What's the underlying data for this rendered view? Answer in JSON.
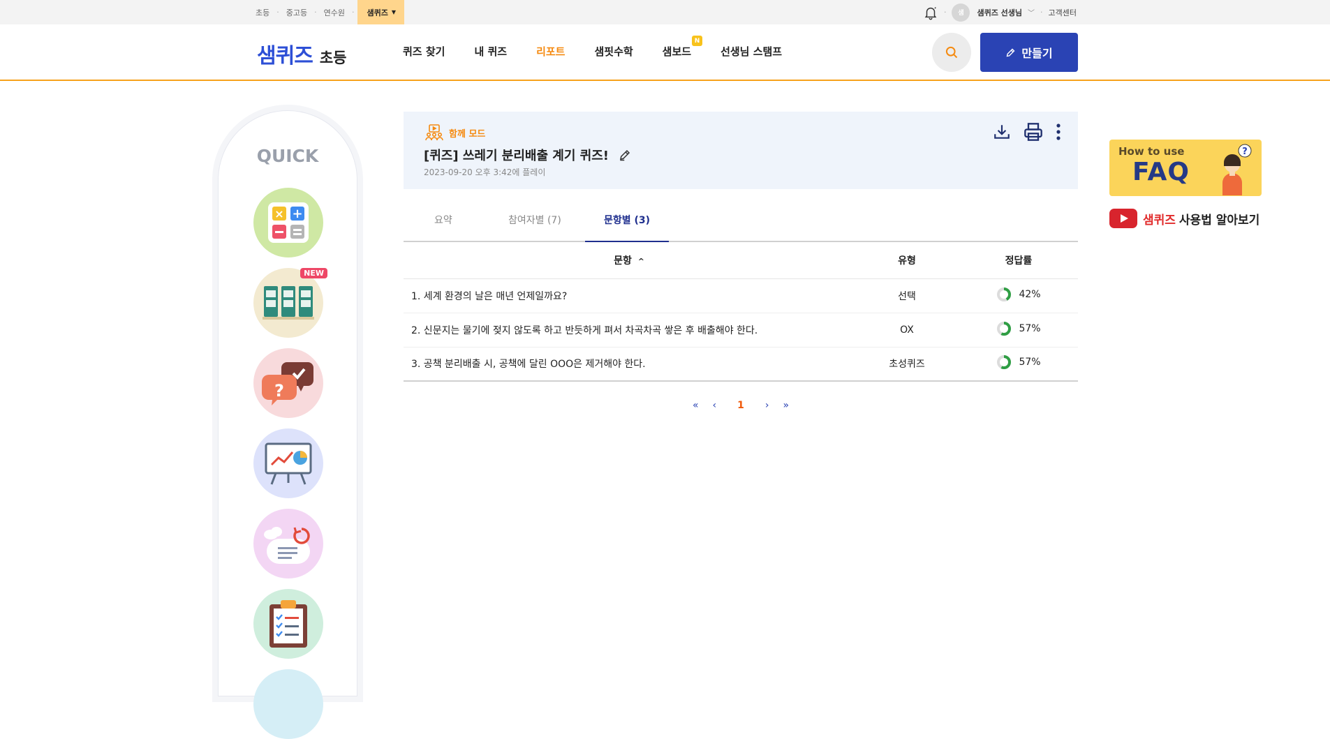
{
  "topbar": {
    "sites": [
      "초등",
      "중고등",
      "연수원"
    ],
    "active_site": "샘퀴즈",
    "user_initial": "샘",
    "user_name": "샘퀴즈 선생님",
    "help": "고객센터"
  },
  "header": {
    "brand": "샘퀴즈",
    "brand_sub": "초등",
    "nav": [
      "퀴즈 찾기",
      "내 퀴즈",
      "리포트",
      "샘핏수학",
      "샘보드",
      "선생님 스탬프"
    ],
    "nav_active_index": 2,
    "new_badge": "N",
    "make_button": "만들기"
  },
  "quick": {
    "title": "QUICK",
    "new_label": "NEW"
  },
  "quiz": {
    "mode": "함께 모드",
    "title": "[퀴즈] 쓰레기 분리배출 계기 퀴즈!",
    "date": "2023-09-20 오후 3:42에 플레이"
  },
  "tabs": [
    "요약",
    "참여자별 (7)",
    "문항별 (3)"
  ],
  "active_tab": 2,
  "table": {
    "headers": [
      "문항",
      "유형",
      "정답률"
    ],
    "sort_indicator": "^",
    "rows": [
      {
        "question": "1. 세계 환경의 날은 매년 언제일까요?",
        "type": "선택",
        "rate": "42%",
        "rate_value": 0.42
      },
      {
        "question": "2. 신문지는 물기에 젖지 않도록 하고 반듯하게 펴서 차곡차곡 쌓은 후 배출해야 한다.",
        "type": "OX",
        "rate": "57%",
        "rate_value": 0.57
      },
      {
        "question": "3. 공책 분리배출 시, 공책에 달린 OOO은 제거해야 한다.",
        "type": "초성퀴즈",
        "rate": "57%",
        "rate_value": 0.57
      }
    ]
  },
  "pager": {
    "first": "«",
    "prev": "‹",
    "current": "1",
    "next": "›",
    "last": "»"
  },
  "banners": {
    "faq_how": "How to use",
    "faq_big": "FAQ",
    "yt_brand": "샘퀴즈",
    "yt_text": "사용법 알아보기"
  },
  "colors": {
    "accent": "#f58a10",
    "primary": "#2a43b4",
    "rate_ring": "#2f9e44"
  }
}
